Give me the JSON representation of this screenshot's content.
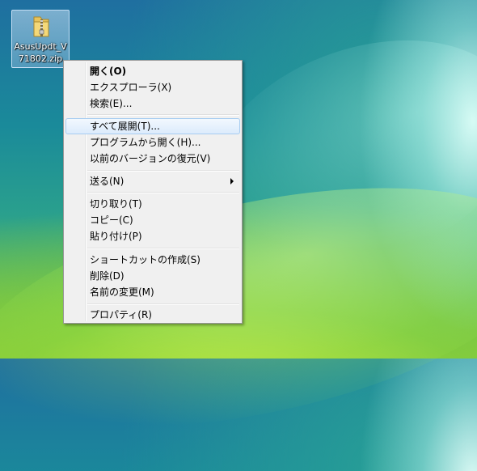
{
  "desktop": {
    "icon_label": "AsusUpdt_V71802.zip"
  },
  "context_menu": {
    "items": [
      {
        "label": "開く(O)"
      },
      {
        "label": "エクスプローラ(X)"
      },
      {
        "label": "検索(E)..."
      },
      {
        "label": "すべて展開(T)..."
      },
      {
        "label": "プログラムから開く(H)..."
      },
      {
        "label": "以前のバージョンの復元(V)"
      },
      {
        "label": "送る(N)"
      },
      {
        "label": "切り取り(T)"
      },
      {
        "label": "コピー(C)"
      },
      {
        "label": "貼り付け(P)"
      },
      {
        "label": "ショートカットの作成(S)"
      },
      {
        "label": "削除(D)"
      },
      {
        "label": "名前の変更(M)"
      },
      {
        "label": "プロパティ(R)"
      }
    ],
    "hovered_item": "すべて展開(T)...",
    "icons": [
      "zip-folder-icon",
      "submenu-arrow-icon"
    ]
  }
}
